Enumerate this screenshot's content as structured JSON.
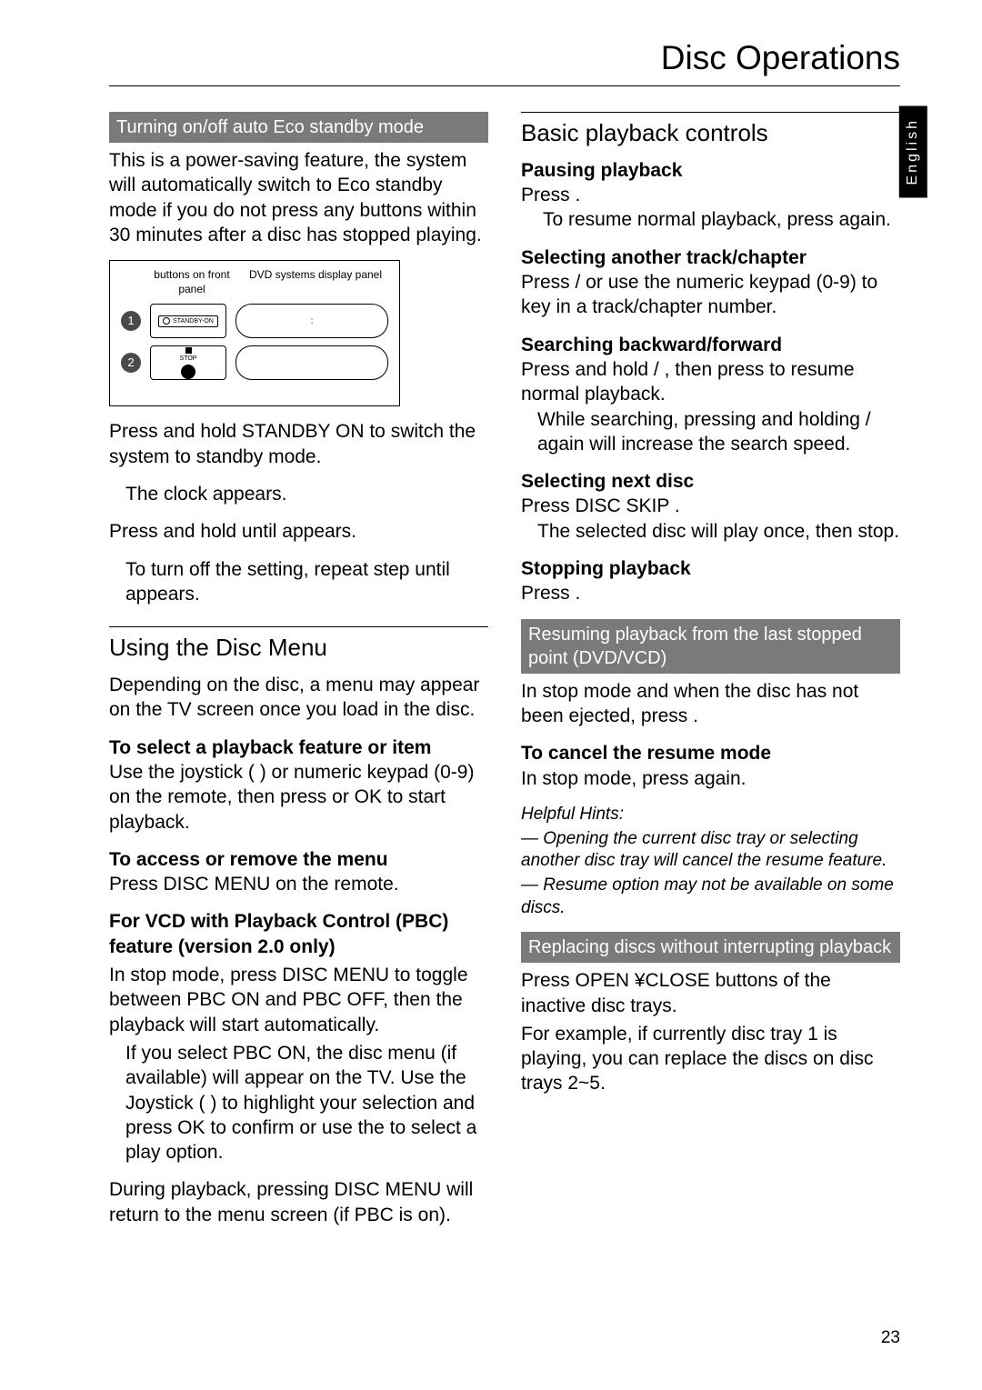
{
  "page_title": "Disc Operations",
  "side_tab": "English",
  "page_number": "23",
  "left": {
    "eco_heading": "Turning on/off auto Eco standby mode",
    "eco_intro": "This is a power-saving feature, the system will automatically switch to Eco standby mode if you do not press any buttons within 30 minutes after a disc has stopped playing.",
    "diag": {
      "col1": "buttons on front panel",
      "col2": "DVD systems display panel",
      "num1": "1",
      "num2": "2",
      "btn1": "STANDBY-ON",
      "btn2_top": "STOP",
      "disp1": ":"
    },
    "eco_step1": "Press and hold STANDBY ON   to switch the system to standby mode.",
    "eco_step1_note": "The clock appears.",
    "eco_step2": "Press and hold    until appears.",
    "eco_step2_note": "To turn off the setting, repeat step until                      appears.",
    "disc_menu_title": "Using the Disc Menu",
    "disc_menu_p1": "Depending on the disc, a menu may appear on the TV screen once you load in the disc.",
    "disc_menu_sub1": "To select a playback feature or item",
    "disc_menu_p2": "Use the joystick (              ) or numeric keypad (0-9)  on the remote, then press        or OK to start playback.",
    "disc_menu_sub2": "To access or remove the menu",
    "disc_menu_p3": "Press DISC MENU  on the remote.",
    "disc_menu_sub3": "For VCD with Playback Control (PBC) feature (version 2.0 only)",
    "disc_menu_p4": "In stop mode, press DISC MENU  to toggle between PBC ON and PBC OFF, then the playback will start automatically.",
    "disc_menu_p4b": "If you select PBC ON, the disc menu (if available) will appear on the TV.  Use the Joystick (              ) to highlight your selection and press OK to confirm or use the to select a play option.",
    "disc_menu_p5": "During playback, pressing DISC MENU will return to the menu screen (if PBC is on)."
  },
  "right": {
    "basic_title": "Basic playback controls",
    "pause_h": "Pausing playback",
    "pause_p": "Press      .",
    "pause_note": "To resume normal playback, press again.",
    "track_h": "Selecting another track/chapter",
    "track_p": "Press        /        or use the numeric keypad (0-9)  to key in a track/chapter number.",
    "search_h": "Searching backward/forward",
    "search_p": "Press and hold        /       , then press to resume normal playback.",
    "search_note": "While searching, pressing and holding        /        again will increase the search speed.",
    "nextdisc_h": "Selecting next disc",
    "nextdisc_p": "Press DISC SKIP .",
    "nextdisc_note": "The selected disc will play once, then stop.",
    "stop_h": "Stopping playback",
    "stop_p": "Press    .",
    "resume_heading": "Resuming playback from the last stopped point (DVD/VCD)",
    "resume_p1": "In stop mode and when the disc has not been ejected, press       .",
    "resume_sub": "To cancel the resume mode",
    "resume_p2": "In stop mode, press    again.",
    "hints_h": "Helpful Hints:",
    "hints_1": "— Opening the current disc tray or selecting another disc tray will cancel the resume feature.",
    "hints_2": "— Resume option may not be available on some discs.",
    "replace_heading": "Replacing discs without interrupting playback",
    "replace_p1": "Press OPEN ¥CLOSE        buttons of the inactive disc trays.",
    "replace_p2": "For example, if currently disc tray 1 is playing, you can replace the discs on disc trays 2~5."
  }
}
